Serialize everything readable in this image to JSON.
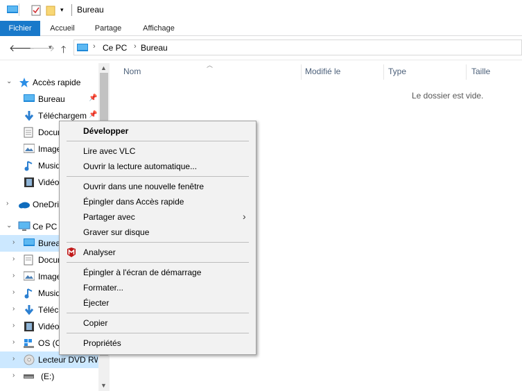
{
  "window": {
    "title": "Bureau"
  },
  "ribbon": {
    "tabs": [
      "Fichier",
      "Accueil",
      "Partage",
      "Affichage"
    ]
  },
  "address": {
    "parts": [
      "Ce PC",
      "Bureau"
    ]
  },
  "navpane": {
    "quick_access": "Accès rapide",
    "items": [
      {
        "label": "Bureau"
      },
      {
        "label": "Téléchargements"
      },
      {
        "label": "Documents"
      },
      {
        "label": "Images"
      },
      {
        "label": "Musique"
      },
      {
        "label": "Vidéos"
      },
      {
        "label": "OneDrive"
      },
      {
        "label": "Ce PC"
      },
      {
        "label": "Bureau"
      },
      {
        "label": "Documents"
      },
      {
        "label": "Images"
      },
      {
        "label": "Musique"
      },
      {
        "label": "Téléchargements"
      },
      {
        "label": "Vidéos"
      },
      {
        "label": "OS (C:)"
      },
      {
        "label": "Lecteur DVD RW"
      },
      {
        "label": "(E:)"
      }
    ]
  },
  "columns": [
    "Nom",
    "Modifié le",
    "Type",
    "Taille"
  ],
  "content": {
    "empty_message": "Le dossier est vide."
  },
  "context_menu": {
    "items": [
      "Développer",
      "Lire avec VLC",
      "Ouvrir la lecture automatique...",
      "Ouvrir dans une nouvelle fenêtre",
      "Épingler dans Accès rapide",
      "Partager avec",
      "Graver sur disque",
      "Analyser",
      "Épingler à l'écran de démarrage",
      "Formater...",
      "Éjecter",
      "Copier",
      "Propriétés"
    ]
  },
  "colors": {
    "accent": "#1979ca",
    "selected": "#cce8ff",
    "menu_bg": "#f2f2f2",
    "mcafee": "#c01818"
  }
}
